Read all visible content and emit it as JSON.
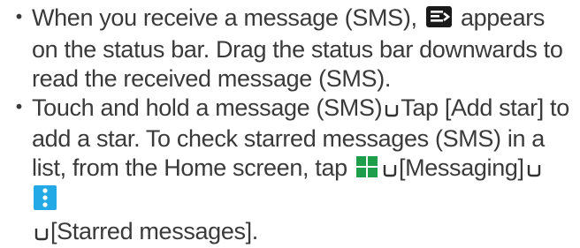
{
  "bullet_glyph": "・",
  "items": [
    {
      "text_1": "When you receive a message (SMS),",
      "icon_1": "message-notification-icon",
      "text_2": "appears on the status bar. Drag the status bar downwards to read the received message (SMS)."
    },
    {
      "text_1": "Touch and hold a message (SMS)",
      "arrow_1": "u",
      "text_2": "Tap [Add star] to add a star. To check starred messages (SMS) in a list, from the Home screen, tap",
      "icon_2": "apps-grid-icon",
      "arrow_2": "u",
      "text_3": "[Messaging]",
      "arrow_3": "u",
      "icon_3": "menu-icon",
      "arrow_4": "u",
      "text_4": "[Starred messages]."
    }
  ],
  "colors": {
    "text": "#3a3a3a",
    "message_icon_bg": "#1a1a1a",
    "apps_icon": "#1e9e4a",
    "menu_icon_bg": "#22a9e6",
    "arrow": "#333333"
  }
}
